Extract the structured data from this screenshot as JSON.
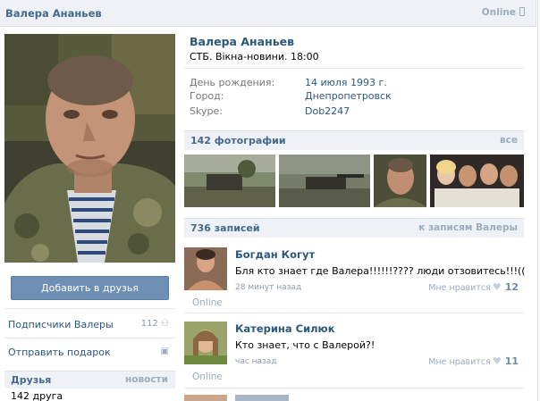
{
  "topbar": {
    "name": "Валера Ананьев",
    "online": "Online"
  },
  "profile": {
    "name": "Валера Ананьев",
    "status": "СТБ. Вікна-новини. 18:00",
    "info": [
      {
        "label": "День рождения:",
        "value": "14 июля 1993 г."
      },
      {
        "label": "Город:",
        "value": "Днепропетровск"
      },
      {
        "label": "Skype:",
        "value": "Dob2247"
      }
    ]
  },
  "photos_bar": {
    "title": "142 фотографии",
    "link": "все"
  },
  "posts_bar": {
    "title": "736 записей",
    "link": "к записям Валеры"
  },
  "left": {
    "add_friend": "Добавить в друзья",
    "followers": {
      "label": "Подписчики Валеры",
      "count": "112"
    },
    "gift": "Отправить подарок",
    "friends_title": "Друзья",
    "friends_link": "новости",
    "friends_count": "142 друга"
  },
  "posts": [
    {
      "author": "Богдан Когут",
      "text": "Бля кто знает где Валера!!!!!!???? люди отзовитесь!!!((",
      "time": "28 минут назад",
      "like_label": "Мне нравится",
      "likes": "12",
      "online": "Online"
    },
    {
      "author": "Катерина Силюк",
      "text": "Кто знает, что с Валерой?!",
      "time": "час назад",
      "like_label": "Мне нравится",
      "likes": "11",
      "online": "Online"
    }
  ],
  "colors": {
    "link": "#2b587a",
    "header": "#45688e",
    "button": "#6d8fb3",
    "bar": "#eef1f5"
  }
}
